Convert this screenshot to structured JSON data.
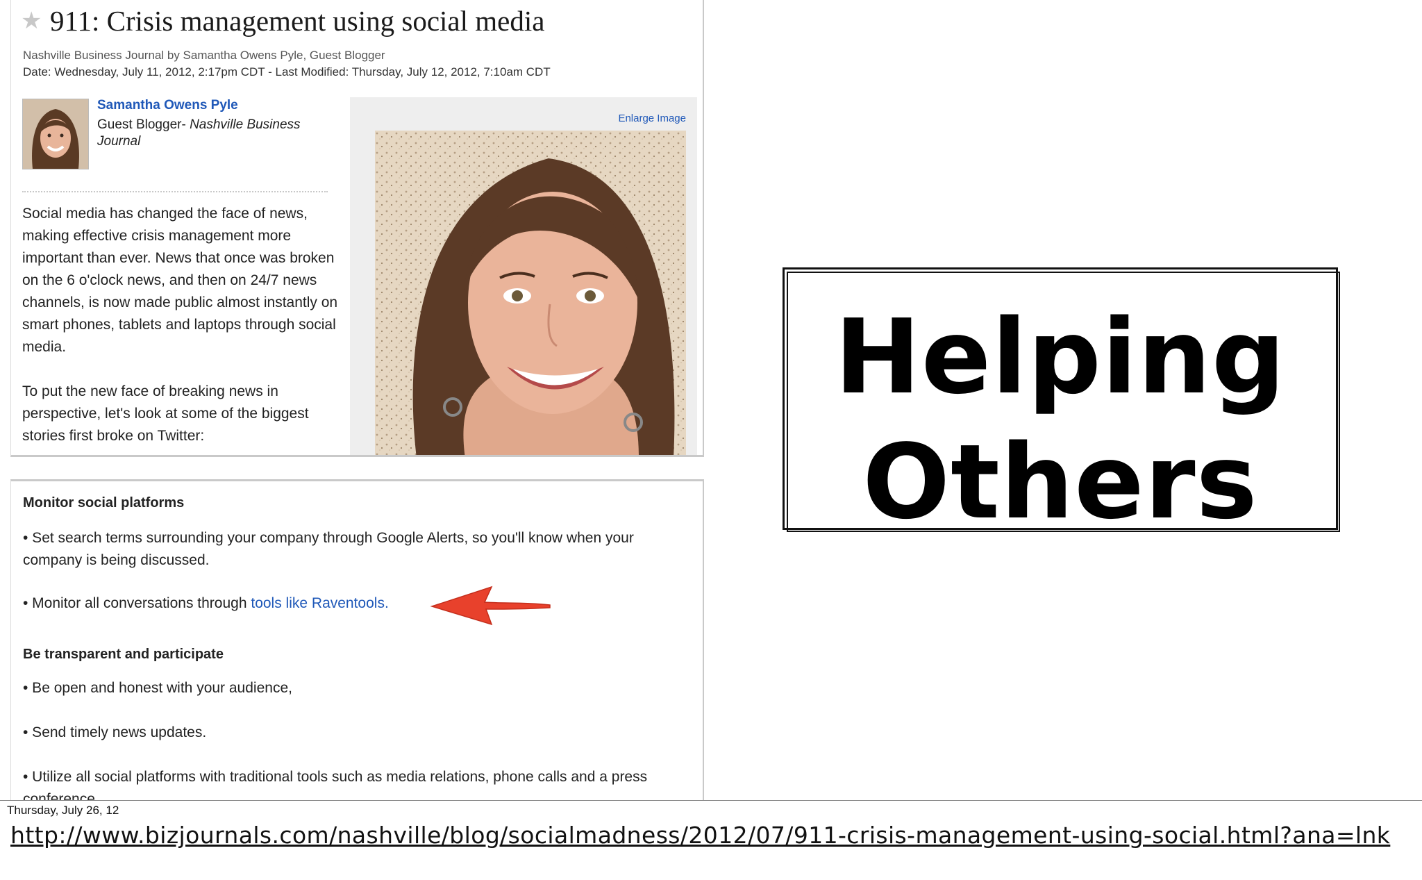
{
  "article": {
    "title": "911: Crisis management using social media",
    "byline": "Nashville Business Journal by Samantha Owens Pyle, Guest Blogger",
    "date": "Date: Wednesday, July 11, 2012, 2:17pm CDT - Last Modified: Thursday, July 12, 2012, 7:10am CDT",
    "author": {
      "name": "Samantha Owens Pyle",
      "role_prefix": "Guest Blogger- ",
      "role_publication": "Nashville Business Journal"
    },
    "enlarge_image": "Enlarge Image",
    "paragraphs": [
      "Social media has changed the face of news, making effective crisis management more important than ever. News that once was broken on the 6 o'clock news, and then on 24/7 news channels, is now made public almost instantly on smart phones, tablets and laptops through social media.",
      "To put the new face of breaking news in perspective, let's look at some of the biggest stories first broke on Twitter:"
    ],
    "sections": {
      "monitor": {
        "heading": "Monitor social platforms",
        "bullet1": "• Set search terms surrounding your company through Google Alerts, so you'll know when your company is being discussed.",
        "bullet2_prefix": "• Monitor all conversations through ",
        "bullet2_link": "tools like Raventools."
      },
      "transparent": {
        "heading": "Be transparent and participate",
        "bullet1": "• Be open and honest with your audience,",
        "bullet2": "• Send timely news updates.",
        "bullet3": "• Utilize all social platforms with traditional tools such as media relations, phone calls and a press conference."
      }
    }
  },
  "slide": {
    "headline_line1": "Helping",
    "headline_line2": "Others"
  },
  "footer": {
    "date": "Thursday, July 26, 12",
    "url": "http://www.bizjournals.com/nashville/blog/socialmadness/2012/07/911-crisis-management-using-social.html?ana=lnk"
  },
  "colors": {
    "link": "#1f58b8",
    "arrow": "#e8412c"
  },
  "icons": {
    "star": "star-icon",
    "arrow": "red-arrow-icon"
  }
}
